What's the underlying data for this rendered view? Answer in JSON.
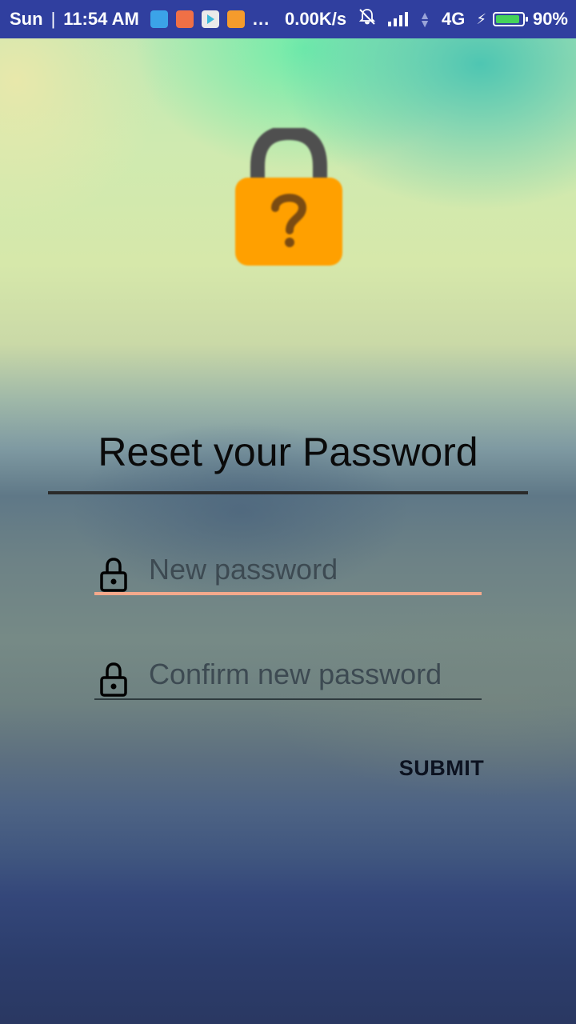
{
  "status_bar": {
    "day": "Sun",
    "separator": "|",
    "time": "11:54 AM",
    "notification_icons": [
      "usb-icon",
      "mi-app-icon",
      "play-store-icon",
      "shopping-app-icon"
    ],
    "more": "...",
    "net_speed": "0.00K/s",
    "network_type": "4G",
    "battery_percent": "90%",
    "battery_level": 0.9
  },
  "header": {
    "icon": "lock-question-icon",
    "title": "Reset your Password"
  },
  "form": {
    "new_password": {
      "placeholder": "New password",
      "value": "",
      "icon": "lock-icon"
    },
    "confirm_password": {
      "placeholder": "Confirm new password",
      "value": "",
      "icon": "lock-icon"
    },
    "submit_label": "SUBMIT"
  },
  "colors": {
    "status_bar": "#303f9f",
    "lock_body": "#ffa000",
    "lock_shackle": "#505050",
    "focused_underline": "#f4a98c",
    "battery_fill": "#45d35a"
  }
}
